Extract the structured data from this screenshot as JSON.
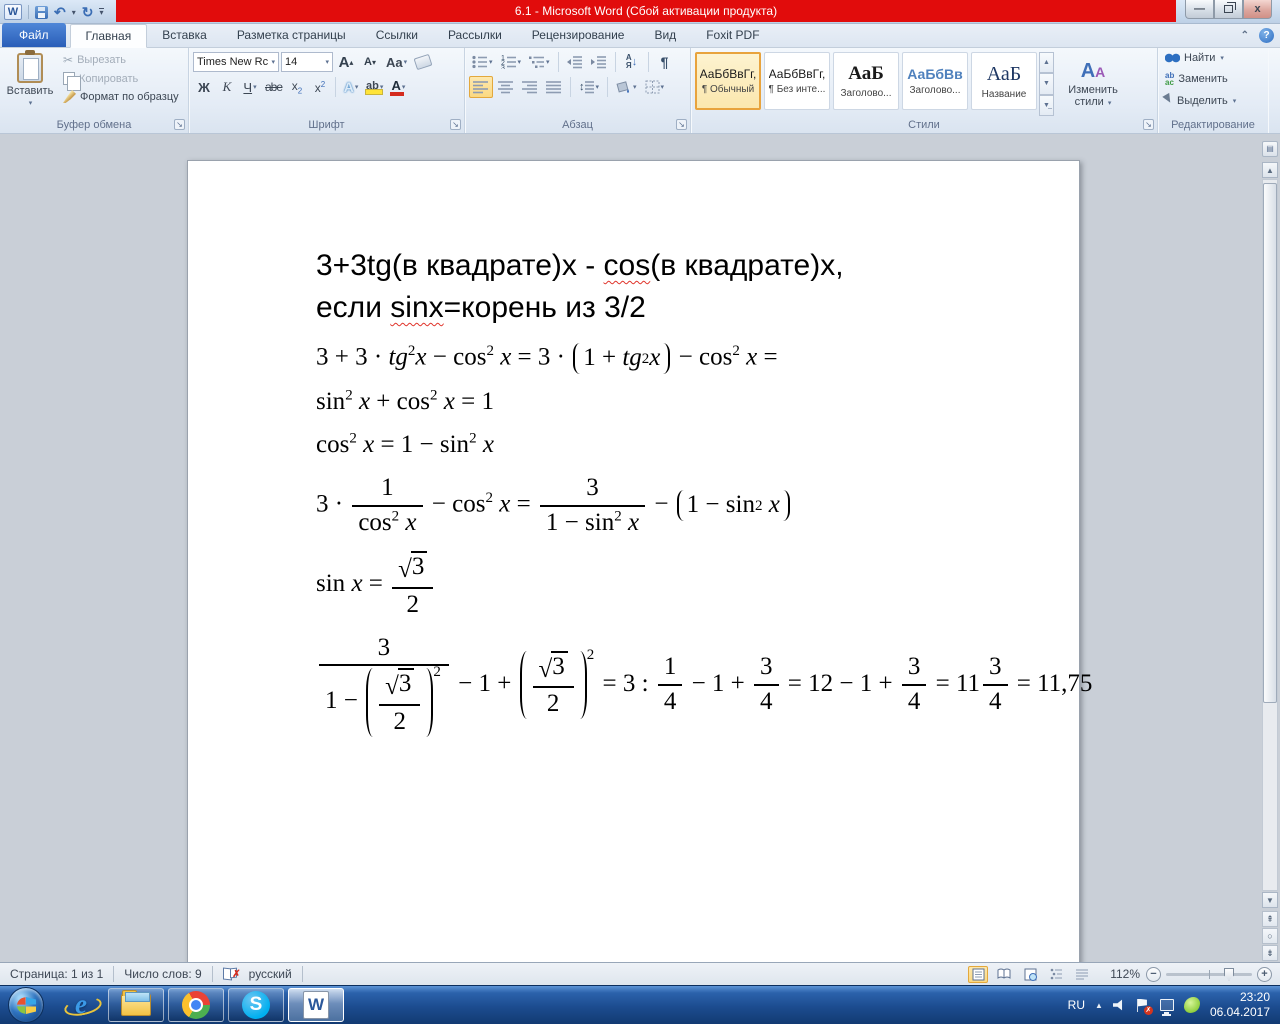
{
  "titlebar": {
    "title": "6.1 - Microsoft Word (Сбой активации продукта)"
  },
  "tabs": [
    {
      "label": "Файл",
      "type": "file"
    },
    {
      "label": "Главная",
      "active": true
    },
    {
      "label": "Вставка"
    },
    {
      "label": "Разметка страницы"
    },
    {
      "label": "Ссылки"
    },
    {
      "label": "Рассылки"
    },
    {
      "label": "Рецензирование"
    },
    {
      "label": "Вид"
    },
    {
      "label": "Foxit PDF"
    }
  ],
  "ribbon": {
    "clipboard": {
      "group": "Буфер обмена",
      "paste": "Вставить",
      "cut": "Вырезать",
      "copy": "Копировать",
      "format_painter": "Формат по образцу"
    },
    "font": {
      "group": "Шрифт",
      "family": "Times New Rc",
      "size": "14",
      "bold": "Ж",
      "italic": "К",
      "underline": "Ч",
      "strike": "abe",
      "case_label": "Aa",
      "grow": "A",
      "shrink": "A",
      "effects": "А",
      "highlight": "ab",
      "color": "А"
    },
    "paragraph": {
      "group": "Абзац",
      "sort_a": "А",
      "sort_z": "Я",
      "pilcrow": "¶"
    },
    "styles": {
      "group": "Стили",
      "change_styles": "Изменить стили",
      "items": [
        {
          "sample": "АаБбВвГг,",
          "label": "¶ Обычный",
          "selected": true,
          "cls": ""
        },
        {
          "sample": "АаБбВвГг,",
          "label": "¶ Без инте...",
          "cls": ""
        },
        {
          "sample": "АаБ",
          "label": "Заголово...",
          "cls": "st-h1"
        },
        {
          "sample": "АаБбВв",
          "label": "Заголово...",
          "cls": "st-h2"
        },
        {
          "sample": "АаБ",
          "label": "Название",
          "cls": "st-title"
        }
      ]
    },
    "editing": {
      "group": "Редактирование",
      "find": "Найти",
      "replace": "Заменить",
      "select": "Выделить"
    }
  },
  "document": {
    "heading": [
      [
        {
          "text": "3+3tg(в квадрате)x - "
        },
        {
          "text": "cos",
          "misspelled": true
        },
        {
          "text": "(в квадрате)x,"
        }
      ],
      [
        {
          "text": "если "
        },
        {
          "text": "sinx",
          "misspelled": true
        },
        {
          "text": "=корень из 3/2"
        }
      ]
    ],
    "formulas": [
      [
        "3 + 3 · ",
        {
          "t": "i",
          "v": "tg"
        },
        {
          "t": "sup",
          "v": "2"
        },
        {
          "t": "i",
          "v": "x"
        },
        " − cos",
        {
          "t": "sup",
          "v": "2"
        },
        " ",
        {
          "t": "i",
          "v": "x"
        },
        " = 3 · ",
        {
          "t": "par",
          "b": [
            "1 + ",
            {
              "t": "i",
              "v": "tg"
            },
            {
              "t": "sup",
              "v": "2"
            },
            {
              "t": "i",
              "v": "x"
            }
          ]
        },
        " − cos",
        {
          "t": "sup",
          "v": "2"
        },
        " ",
        {
          "t": "i",
          "v": "x"
        },
        " ="
      ],
      [
        "sin",
        {
          "t": "sup",
          "v": "2"
        },
        " ",
        {
          "t": "i",
          "v": "x"
        },
        " + cos",
        {
          "t": "sup",
          "v": "2"
        },
        " ",
        {
          "t": "i",
          "v": "x"
        },
        " = 1"
      ],
      [
        "cos",
        {
          "t": "sup",
          "v": "2"
        },
        " ",
        {
          "t": "i",
          "v": "x"
        },
        " = 1 − sin",
        {
          "t": "sup",
          "v": "2"
        },
        " ",
        {
          "t": "i",
          "v": "x"
        }
      ],
      [
        "3 · ",
        {
          "t": "frac",
          "n": [
            "1"
          ],
          "d": [
            "cos",
            {
              "t": "sup",
              "v": "2"
            },
            " ",
            {
              "t": "i",
              "v": "x"
            }
          ]
        },
        " − cos",
        {
          "t": "sup",
          "v": "2"
        },
        " ",
        {
          "t": "i",
          "v": "x"
        },
        " = ",
        {
          "t": "frac",
          "n": [
            "3"
          ],
          "d": [
            "1 − sin",
            {
              "t": "sup",
              "v": "2"
            },
            " ",
            {
              "t": "i",
              "v": "x"
            }
          ]
        },
        " − ",
        {
          "t": "par",
          "b": [
            "1 − sin",
            {
              "t": "sup",
              "v": "2"
            },
            " ",
            {
              "t": "i",
              "v": "x"
            }
          ]
        }
      ],
      [
        "sin ",
        {
          "t": "i",
          "v": "x"
        },
        " = ",
        {
          "t": "frac",
          "n": [
            {
              "t": "sqrt",
              "a": [
                "3"
              ]
            }
          ],
          "d": [
            "2"
          ]
        }
      ],
      [
        {
          "t": "frac",
          "n": [
            "3"
          ],
          "d": [
            "1 − ",
            {
              "t": "par",
              "b": [
                {
                  "t": "frac",
                  "n": [
                    {
                      "t": "sqrt",
                      "a": [
                        "3"
                      ]
                    }
                  ],
                  "d": [
                    "2"
                  ]
                }
              ],
              "sup": "2"
            }
          ]
        },
        " − 1 + ",
        {
          "t": "par",
          "b": [
            {
              "t": "frac",
              "n": [
                {
                  "t": "sqrt",
                  "a": [
                    "3"
                  ]
                }
              ],
              "d": [
                "2"
              ]
            }
          ],
          "sup": "2"
        },
        " = 3 : ",
        {
          "t": "frac",
          "n": [
            "1"
          ],
          "d": [
            "4"
          ]
        },
        " − 1 + ",
        {
          "t": "frac",
          "n": [
            "3"
          ],
          "d": [
            "4"
          ]
        },
        " = 12 − 1 + ",
        {
          "t": "frac",
          "n": [
            "3"
          ],
          "d": [
            "4"
          ]
        },
        " = 11",
        {
          "t": "frac",
          "n": [
            "3"
          ],
          "d": [
            "4"
          ]
        },
        " = 11,75"
      ]
    ]
  },
  "statusbar": {
    "page": "Страница: 1 из 1",
    "words": "Число слов: 9",
    "language": "русский",
    "zoom": "112%"
  },
  "taskbar": {
    "lang": "RU",
    "time": "23:20",
    "date": "06.04.2017"
  },
  "colors": {
    "titlebar_red": "#e10c0c",
    "selection_orange": "#e8a33d",
    "accent_blue": "#2b579a"
  }
}
